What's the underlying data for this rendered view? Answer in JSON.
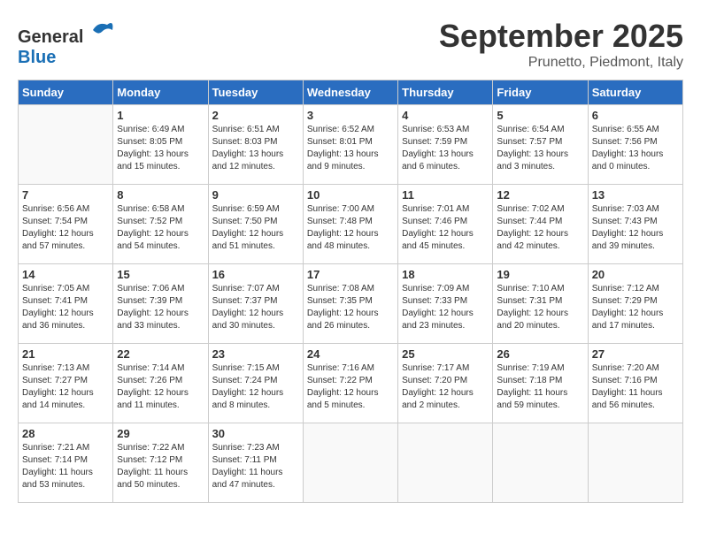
{
  "logo": {
    "general": "General",
    "blue": "Blue"
  },
  "header": {
    "month": "September 2025",
    "location": "Prunetto, Piedmont, Italy"
  },
  "weekdays": [
    "Sunday",
    "Monday",
    "Tuesday",
    "Wednesday",
    "Thursday",
    "Friday",
    "Saturday"
  ],
  "weeks": [
    [
      {
        "day": "",
        "sunrise": "",
        "sunset": "",
        "daylight": ""
      },
      {
        "day": "1",
        "sunrise": "Sunrise: 6:49 AM",
        "sunset": "Sunset: 8:05 PM",
        "daylight": "Daylight: 13 hours and 15 minutes."
      },
      {
        "day": "2",
        "sunrise": "Sunrise: 6:51 AM",
        "sunset": "Sunset: 8:03 PM",
        "daylight": "Daylight: 13 hours and 12 minutes."
      },
      {
        "day": "3",
        "sunrise": "Sunrise: 6:52 AM",
        "sunset": "Sunset: 8:01 PM",
        "daylight": "Daylight: 13 hours and 9 minutes."
      },
      {
        "day": "4",
        "sunrise": "Sunrise: 6:53 AM",
        "sunset": "Sunset: 7:59 PM",
        "daylight": "Daylight: 13 hours and 6 minutes."
      },
      {
        "day": "5",
        "sunrise": "Sunrise: 6:54 AM",
        "sunset": "Sunset: 7:57 PM",
        "daylight": "Daylight: 13 hours and 3 minutes."
      },
      {
        "day": "6",
        "sunrise": "Sunrise: 6:55 AM",
        "sunset": "Sunset: 7:56 PM",
        "daylight": "Daylight: 13 hours and 0 minutes."
      }
    ],
    [
      {
        "day": "7",
        "sunrise": "Sunrise: 6:56 AM",
        "sunset": "Sunset: 7:54 PM",
        "daylight": "Daylight: 12 hours and 57 minutes."
      },
      {
        "day": "8",
        "sunrise": "Sunrise: 6:58 AM",
        "sunset": "Sunset: 7:52 PM",
        "daylight": "Daylight: 12 hours and 54 minutes."
      },
      {
        "day": "9",
        "sunrise": "Sunrise: 6:59 AM",
        "sunset": "Sunset: 7:50 PM",
        "daylight": "Daylight: 12 hours and 51 minutes."
      },
      {
        "day": "10",
        "sunrise": "Sunrise: 7:00 AM",
        "sunset": "Sunset: 7:48 PM",
        "daylight": "Daylight: 12 hours and 48 minutes."
      },
      {
        "day": "11",
        "sunrise": "Sunrise: 7:01 AM",
        "sunset": "Sunset: 7:46 PM",
        "daylight": "Daylight: 12 hours and 45 minutes."
      },
      {
        "day": "12",
        "sunrise": "Sunrise: 7:02 AM",
        "sunset": "Sunset: 7:44 PM",
        "daylight": "Daylight: 12 hours and 42 minutes."
      },
      {
        "day": "13",
        "sunrise": "Sunrise: 7:03 AM",
        "sunset": "Sunset: 7:43 PM",
        "daylight": "Daylight: 12 hours and 39 minutes."
      }
    ],
    [
      {
        "day": "14",
        "sunrise": "Sunrise: 7:05 AM",
        "sunset": "Sunset: 7:41 PM",
        "daylight": "Daylight: 12 hours and 36 minutes."
      },
      {
        "day": "15",
        "sunrise": "Sunrise: 7:06 AM",
        "sunset": "Sunset: 7:39 PM",
        "daylight": "Daylight: 12 hours and 33 minutes."
      },
      {
        "day": "16",
        "sunrise": "Sunrise: 7:07 AM",
        "sunset": "Sunset: 7:37 PM",
        "daylight": "Daylight: 12 hours and 30 minutes."
      },
      {
        "day": "17",
        "sunrise": "Sunrise: 7:08 AM",
        "sunset": "Sunset: 7:35 PM",
        "daylight": "Daylight: 12 hours and 26 minutes."
      },
      {
        "day": "18",
        "sunrise": "Sunrise: 7:09 AM",
        "sunset": "Sunset: 7:33 PM",
        "daylight": "Daylight: 12 hours and 23 minutes."
      },
      {
        "day": "19",
        "sunrise": "Sunrise: 7:10 AM",
        "sunset": "Sunset: 7:31 PM",
        "daylight": "Daylight: 12 hours and 20 minutes."
      },
      {
        "day": "20",
        "sunrise": "Sunrise: 7:12 AM",
        "sunset": "Sunset: 7:29 PM",
        "daylight": "Daylight: 12 hours and 17 minutes."
      }
    ],
    [
      {
        "day": "21",
        "sunrise": "Sunrise: 7:13 AM",
        "sunset": "Sunset: 7:27 PM",
        "daylight": "Daylight: 12 hours and 14 minutes."
      },
      {
        "day": "22",
        "sunrise": "Sunrise: 7:14 AM",
        "sunset": "Sunset: 7:26 PM",
        "daylight": "Daylight: 12 hours and 11 minutes."
      },
      {
        "day": "23",
        "sunrise": "Sunrise: 7:15 AM",
        "sunset": "Sunset: 7:24 PM",
        "daylight": "Daylight: 12 hours and 8 minutes."
      },
      {
        "day": "24",
        "sunrise": "Sunrise: 7:16 AM",
        "sunset": "Sunset: 7:22 PM",
        "daylight": "Daylight: 12 hours and 5 minutes."
      },
      {
        "day": "25",
        "sunrise": "Sunrise: 7:17 AM",
        "sunset": "Sunset: 7:20 PM",
        "daylight": "Daylight: 12 hours and 2 minutes."
      },
      {
        "day": "26",
        "sunrise": "Sunrise: 7:19 AM",
        "sunset": "Sunset: 7:18 PM",
        "daylight": "Daylight: 11 hours and 59 minutes."
      },
      {
        "day": "27",
        "sunrise": "Sunrise: 7:20 AM",
        "sunset": "Sunset: 7:16 PM",
        "daylight": "Daylight: 11 hours and 56 minutes."
      }
    ],
    [
      {
        "day": "28",
        "sunrise": "Sunrise: 7:21 AM",
        "sunset": "Sunset: 7:14 PM",
        "daylight": "Daylight: 11 hours and 53 minutes."
      },
      {
        "day": "29",
        "sunrise": "Sunrise: 7:22 AM",
        "sunset": "Sunset: 7:12 PM",
        "daylight": "Daylight: 11 hours and 50 minutes."
      },
      {
        "day": "30",
        "sunrise": "Sunrise: 7:23 AM",
        "sunset": "Sunset: 7:11 PM",
        "daylight": "Daylight: 11 hours and 47 minutes."
      },
      {
        "day": "",
        "sunrise": "",
        "sunset": "",
        "daylight": ""
      },
      {
        "day": "",
        "sunrise": "",
        "sunset": "",
        "daylight": ""
      },
      {
        "day": "",
        "sunrise": "",
        "sunset": "",
        "daylight": ""
      },
      {
        "day": "",
        "sunrise": "",
        "sunset": "",
        "daylight": ""
      }
    ]
  ]
}
